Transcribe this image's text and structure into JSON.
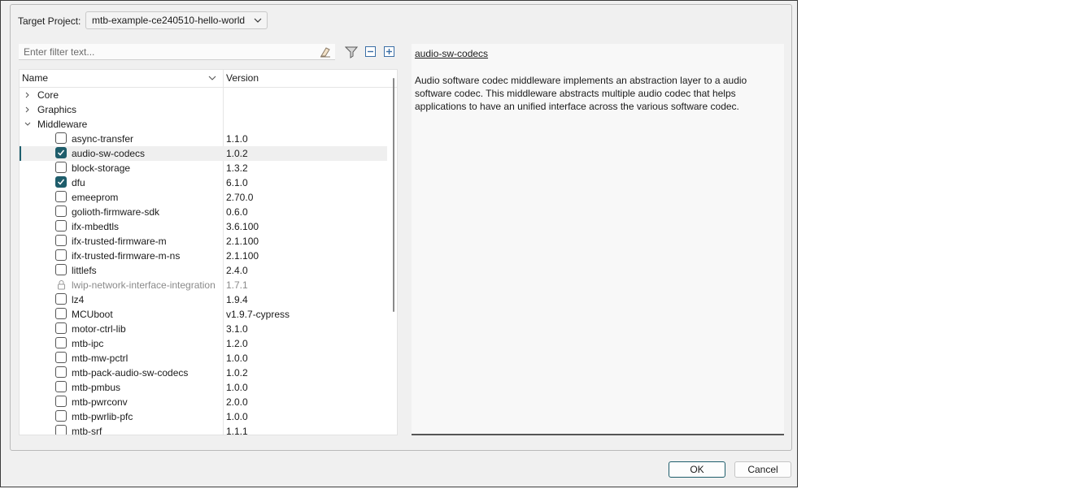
{
  "target_project": {
    "label": "Target Project:",
    "value": "mtb-example-ce240510-hello-world"
  },
  "filter": {
    "placeholder": "Enter filter text..."
  },
  "toolbar": {
    "icons": [
      "filter-icon",
      "collapse-all-icon",
      "expand-all-icon"
    ]
  },
  "tree": {
    "headers": {
      "name": "Name",
      "version": "Version"
    },
    "categories": [
      {
        "label": "Core",
        "expanded": false
      },
      {
        "label": "Graphics",
        "expanded": false
      },
      {
        "label": "Middleware",
        "expanded": true
      }
    ],
    "items": [
      {
        "name": "async-transfer",
        "version": "1.1.0",
        "checked": false
      },
      {
        "name": "audio-sw-codecs",
        "version": "1.0.2",
        "checked": true,
        "selected": true
      },
      {
        "name": "block-storage",
        "version": "1.3.2",
        "checked": false
      },
      {
        "name": "dfu",
        "version": "6.1.0",
        "checked": true
      },
      {
        "name": "emeeprom",
        "version": "2.70.0",
        "checked": false
      },
      {
        "name": "golioth-firmware-sdk",
        "version": "0.6.0",
        "checked": false
      },
      {
        "name": "ifx-mbedtls",
        "version": "3.6.100",
        "checked": false
      },
      {
        "name": "ifx-trusted-firmware-m",
        "version": "2.1.100",
        "checked": false
      },
      {
        "name": "ifx-trusted-firmware-m-ns",
        "version": "2.1.100",
        "checked": false
      },
      {
        "name": "littlefs",
        "version": "2.4.0",
        "checked": false
      },
      {
        "name": "lwip-network-interface-integration",
        "version": "1.7.1",
        "checked": false,
        "locked": true
      },
      {
        "name": "lz4",
        "version": "1.9.4",
        "checked": false
      },
      {
        "name": "MCUboot",
        "version": "v1.9.7-cypress",
        "checked": false
      },
      {
        "name": "motor-ctrl-lib",
        "version": "3.1.0",
        "checked": false
      },
      {
        "name": "mtb-ipc",
        "version": "1.2.0",
        "checked": false
      },
      {
        "name": "mtb-mw-pctrl",
        "version": "1.0.0",
        "checked": false
      },
      {
        "name": "mtb-pack-audio-sw-codecs",
        "version": "1.0.2",
        "checked": false
      },
      {
        "name": "mtb-pmbus",
        "version": "1.0.0",
        "checked": false
      },
      {
        "name": "mtb-pwrconv",
        "version": "2.0.0",
        "checked": false
      },
      {
        "name": "mtb-pwrlib-pfc",
        "version": "1.0.0",
        "checked": false
      },
      {
        "name": "mtb-srf",
        "version": "1.1.1",
        "checked": false
      }
    ]
  },
  "description": {
    "title": "audio-sw-codecs",
    "text": "Audio software codec middleware implements an abstraction layer to a audio software codec. This middleware abstracts multiple audio codec that helps applications to have an unified interface across the various software codec."
  },
  "buttons": {
    "ok": "OK",
    "cancel": "Cancel"
  },
  "colors": {
    "accent": "#1e5d6b",
    "dialog_bg": "#f0f0f0"
  }
}
